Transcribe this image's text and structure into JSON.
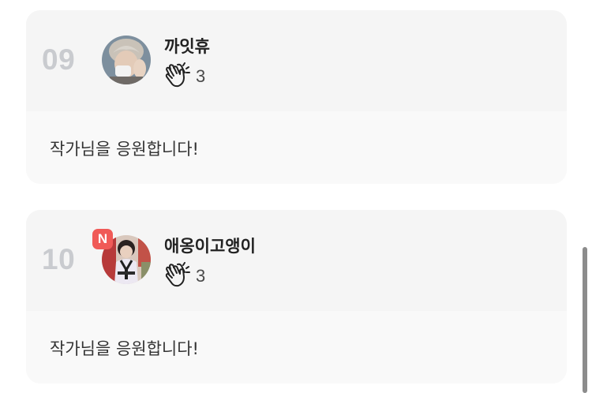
{
  "comments": [
    {
      "rank": "09",
      "name": "까잇휴",
      "clap_count": "3",
      "message": "작가님을 응원합니다!",
      "is_new": false
    },
    {
      "rank": "10",
      "name": "애옹이고앵이",
      "clap_count": "3",
      "message": "작가님을 응원합니다!",
      "is_new": true,
      "new_badge": "N"
    }
  ],
  "icons": {
    "clap": "clapping-hands-icon"
  },
  "colors": {
    "rank": "#c9cbcf",
    "new_badge": "#f05a57",
    "card": "#f6f6f6"
  }
}
